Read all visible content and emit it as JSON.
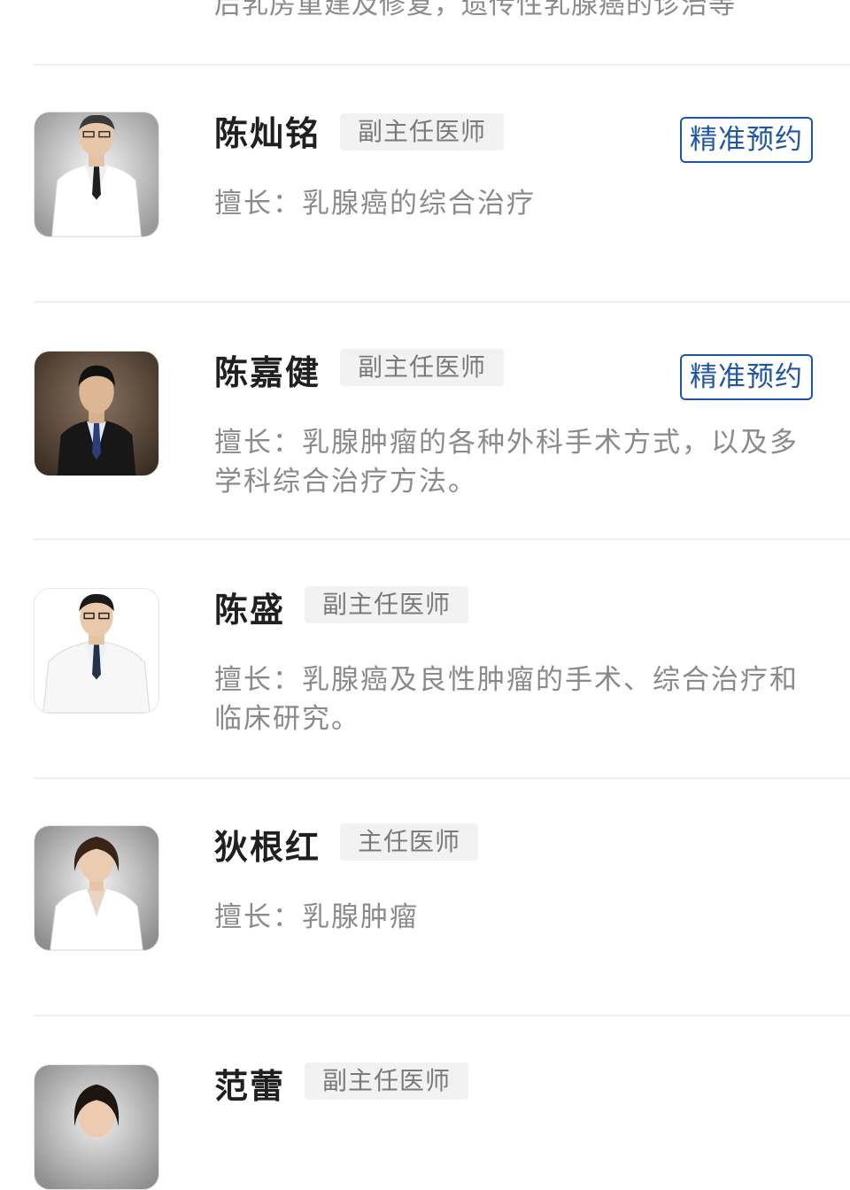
{
  "previous_item": {
    "specialty_tail": "后乳房重建及修复，遗传性乳腺癌的诊治等"
  },
  "doctors": [
    {
      "name": "陈灿铭",
      "title": "副主任医师",
      "book_label": "精准预约",
      "specialty": "擅长：乳腺癌的综合治疗"
    },
    {
      "name": "陈嘉健",
      "title": "副主任医师",
      "book_label": "精准预约",
      "specialty": "擅长：乳腺肿瘤的各种外科手术方式，以及多学科综合治疗方法。"
    },
    {
      "name": "陈盛",
      "title": "副主任医师",
      "specialty": "擅长：乳腺癌及良性肿瘤的手术、综合治疗和临床研究。"
    },
    {
      "name": "狄根红",
      "title": "主任医师",
      "specialty": "擅长：乳腺肿瘤"
    },
    {
      "name": "范蕾",
      "title": "副主任医师"
    }
  ],
  "colors": {
    "accent": "#1f56a5",
    "name_text": "#1f1f1f",
    "muted_text": "#8a8a8a",
    "badge_bg": "#f2f2f2",
    "divider": "#ededed"
  }
}
